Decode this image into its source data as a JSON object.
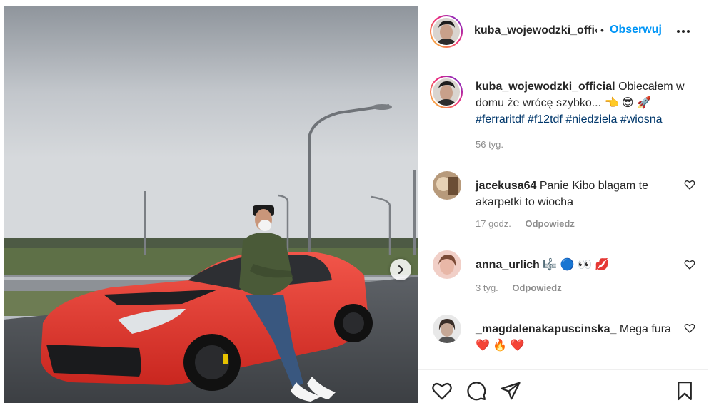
{
  "post": {
    "author": "kuba_wojewodzki_official",
    "author_truncated": "kuba_wojewodzki_offi‹",
    "separator": "•",
    "follow_label": "Obserwuj",
    "caption": {
      "username": "kuba_wojewodzki_official",
      "text": "Obiecałem w domu że wrócę szybko... ",
      "emojis": "👈 😎 🚀",
      "hashtags": [
        "#ferraritdf",
        "#f12tdf",
        "#niedziela",
        "#wiosna"
      ],
      "time": "56 tyg."
    }
  },
  "comments": [
    {
      "username": "jacekusa64",
      "text": "Panie Kibo blagam te akarpetki to wiocha",
      "time": "17 godz.",
      "reply_label": "Odpowiedz"
    },
    {
      "username": "anna_urlich",
      "text": "🎼 🔵 👀 💋",
      "time": "3 tyg.",
      "reply_label": "Odpowiedz"
    },
    {
      "username": "_magdalenakapuscinska_",
      "text": "Mega fura",
      "emojis": "❤️ 🔥 ❤️"
    }
  ],
  "icons": {
    "more": "more-options-icon",
    "carousel": "chevron-right-icon",
    "like": "heart-icon",
    "comment": "comment-icon",
    "share": "paper-plane-icon",
    "save": "bookmark-icon"
  },
  "colors": {
    "accent": "#0095f6",
    "hashtag": "#00376b",
    "muted": "#8e8e8e",
    "text": "#262626",
    "car": "#e8392f"
  }
}
